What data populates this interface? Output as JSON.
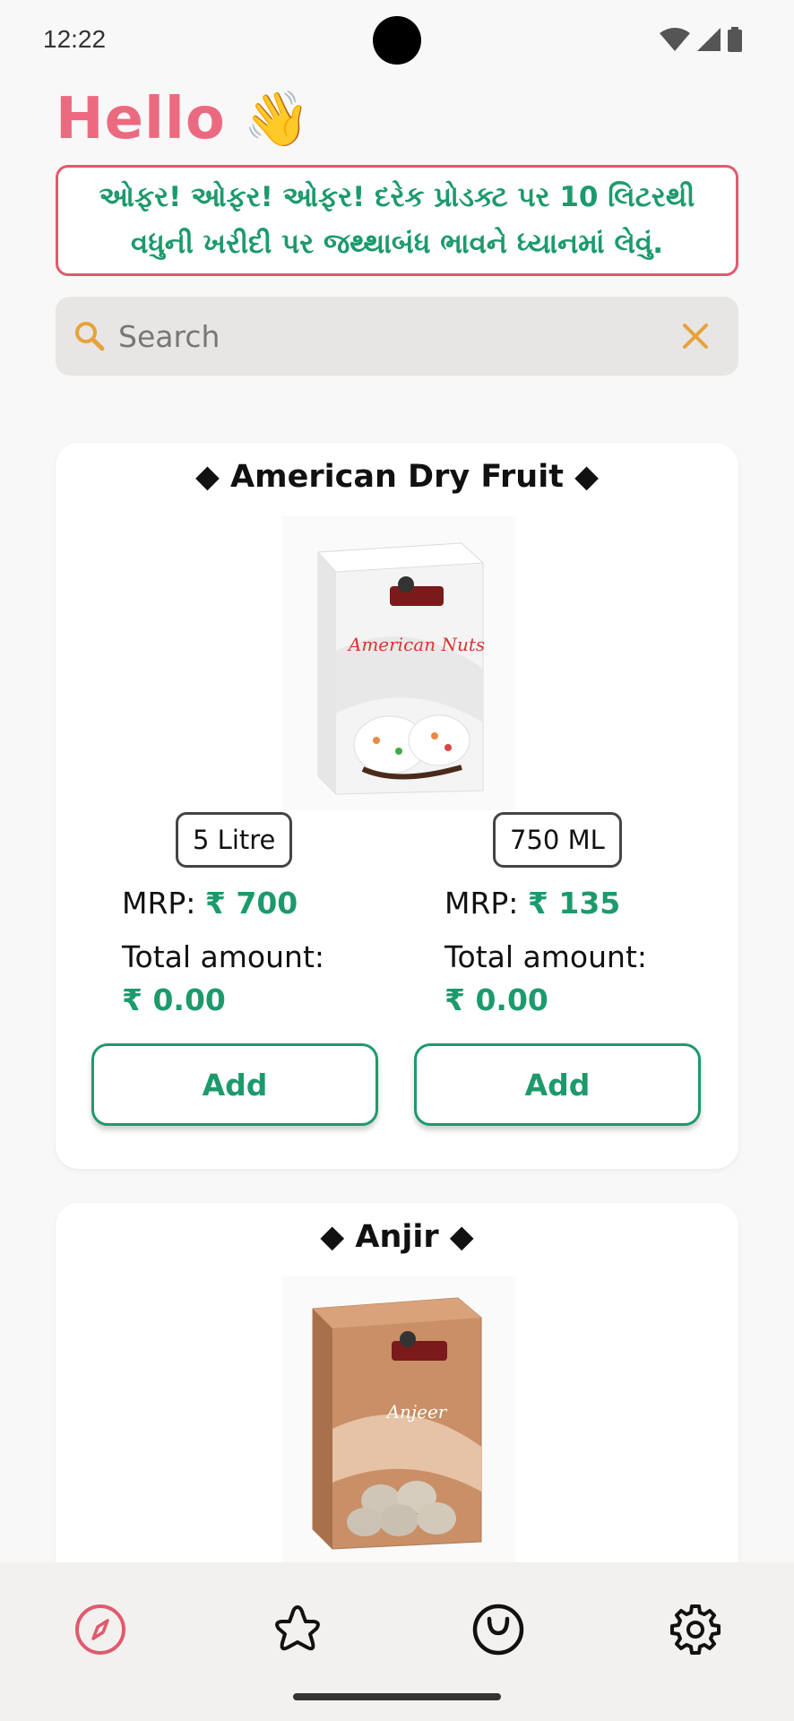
{
  "status_bar": {
    "time": "12:22"
  },
  "greeting": {
    "text": "Hello",
    "emoji": "👋"
  },
  "offer": {
    "text": "ઓફર! ઓફર! ઓફર! દરેક પ્રોડક્ટ પર 10 લિટરથી વધુની ખરીદી પર જથ્થાબંધ ભાવને ધ્યાનમાં લેવું."
  },
  "search": {
    "placeholder": "Search",
    "value": ""
  },
  "products": [
    {
      "title": "◆ American Dry Fruit ◆",
      "image_label": "American Nuts",
      "variants": [
        {
          "size": "5 Litre",
          "mrp_label": "MRP: ",
          "mrp_value": "₹ 700",
          "total_label": "Total amount:",
          "total_value": "₹ 0.00",
          "add_label": "Add"
        },
        {
          "size": "750 ML",
          "mrp_label": "MRP: ",
          "mrp_value": "₹ 135",
          "total_label": "Total amount:",
          "total_value": "₹ 0.00",
          "add_label": "Add"
        }
      ]
    },
    {
      "title": "◆ Anjir ◆",
      "image_label": "Anjeer"
    }
  ],
  "nav": {
    "items": [
      "explore-icon",
      "favorites-icon",
      "cart-icon",
      "settings-icon"
    ],
    "active_color": "#e05a6e"
  },
  "colors": {
    "accent": "#1d9a6c",
    "brand_pink": "#ec6a80",
    "search_icon": "#e6a23c"
  }
}
